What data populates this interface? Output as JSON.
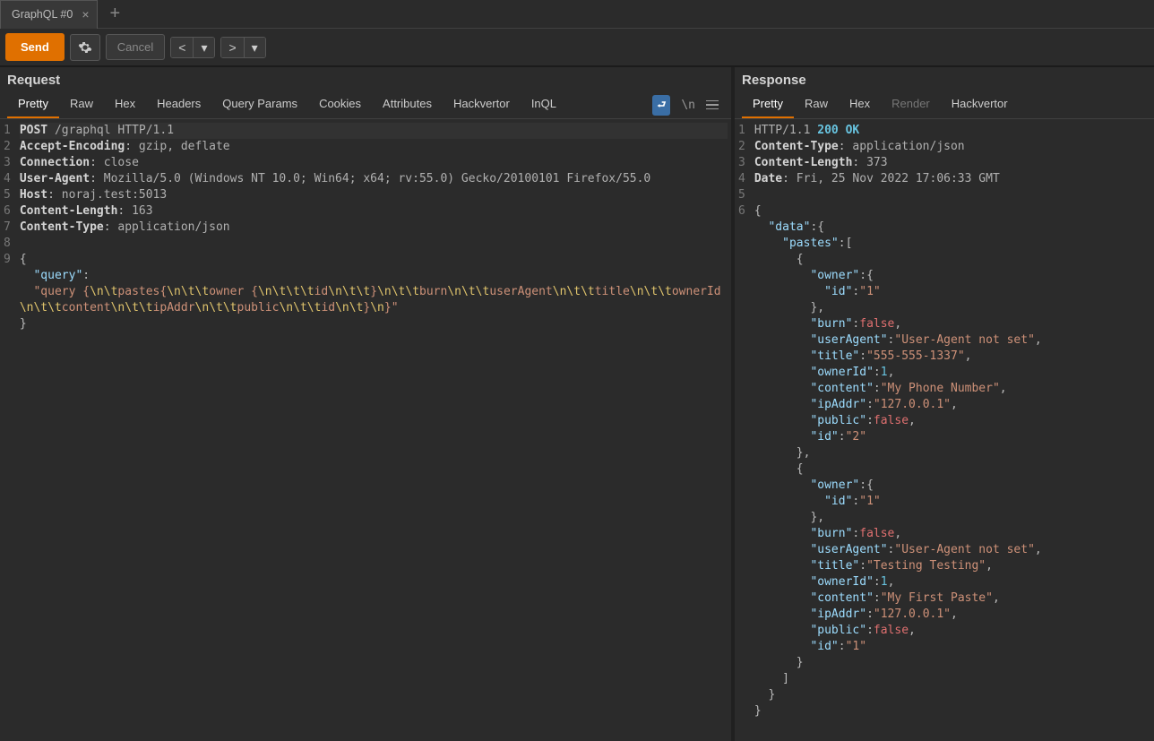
{
  "tab": {
    "title": "GraphQL #0"
  },
  "toolbar": {
    "send": "Send",
    "cancel": "Cancel"
  },
  "request": {
    "title": "Request",
    "tabs": [
      "Pretty",
      "Raw",
      "Hex",
      "Headers",
      "Query Params",
      "Cookies",
      "Attributes",
      "Hackvertor",
      "InQL"
    ],
    "activeTab": 0,
    "lineNumbers": [
      "1",
      "2",
      "3",
      "4",
      "5",
      "6",
      "7",
      "8",
      "9"
    ],
    "http": {
      "method": "POST",
      "path": "/graphql",
      "version": "HTTP/1.1",
      "headers": [
        {
          "name": "Accept-Encoding",
          "value": "gzip, deflate"
        },
        {
          "name": "Connection",
          "value": "close"
        },
        {
          "name": "User-Agent",
          "value": "Mozilla/5.0 (Windows NT 10.0; Win64; x64; rv:55.0) Gecko/20100101 Firefox/55.0"
        },
        {
          "name": "Host",
          "value": "noraj.test:5013"
        },
        {
          "name": "Content-Length",
          "value": "163"
        },
        {
          "name": "Content-Type",
          "value": "application/json"
        }
      ],
      "body": {
        "query_key": "\"query\"",
        "query_value": "\"query {\\n\\tpastes{\\n\\t\\towner {\\n\\t\\t\\tid\\n\\t\\t}\\n\\t\\tburn\\n\\t\\tuserAgent\\n\\t\\ttitle\\n\\t\\townerId\\n\\t\\tcontent\\n\\t\\tipAddr\\n\\t\\tpublic\\n\\t\\tid\\n\\t}\\n}\""
      }
    }
  },
  "response": {
    "title": "Response",
    "tabs": [
      "Pretty",
      "Raw",
      "Hex",
      "Render",
      "Hackvertor"
    ],
    "activeTab": 0,
    "lineNumbers": [
      "1",
      "2",
      "3",
      "4",
      "5",
      "6"
    ],
    "http": {
      "version": "HTTP/1.1",
      "status": "200 OK",
      "headers": [
        {
          "name": "Content-Type",
          "value": "application/json"
        },
        {
          "name": "Content-Length",
          "value": "373"
        },
        {
          "name": "Date",
          "value": "Fri, 25 Nov 2022 17:06:33 GMT"
        }
      ],
      "body_json": {
        "data": {
          "pastes": [
            {
              "owner": {
                "id": "1"
              },
              "burn": false,
              "userAgent": "User-Agent not set",
              "title": "555-555-1337",
              "ownerId": 1,
              "content": "My Phone Number",
              "ipAddr": "127.0.0.1",
              "public": false,
              "id": "2"
            },
            {
              "owner": {
                "id": "1"
              },
              "burn": false,
              "userAgent": "User-Agent not set",
              "title": "Testing Testing",
              "ownerId": 1,
              "content": "My First Paste",
              "ipAddr": "127.0.0.1",
              "public": false,
              "id": "1"
            }
          ]
        }
      }
    }
  },
  "iconbar": {
    "wrap": "↩",
    "newline": "\\n"
  }
}
